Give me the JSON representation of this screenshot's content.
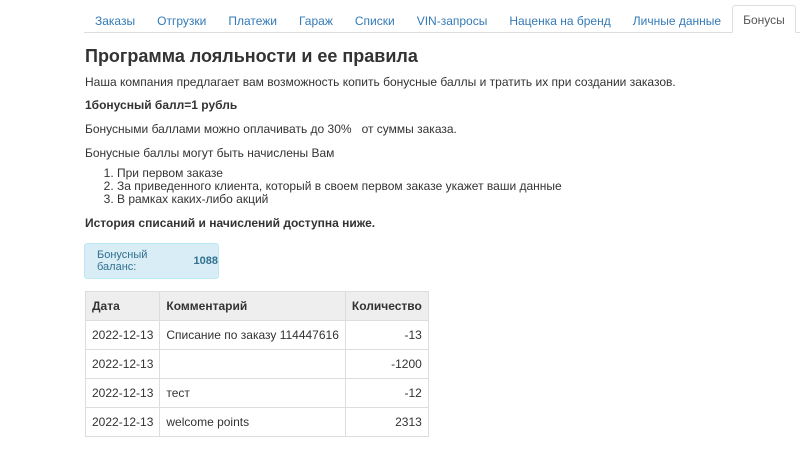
{
  "tabs": [
    {
      "label": "Заказы",
      "active": false
    },
    {
      "label": "Отгрузки",
      "active": false
    },
    {
      "label": "Платежи",
      "active": false
    },
    {
      "label": "Гараж",
      "active": false
    },
    {
      "label": "Списки",
      "active": false
    },
    {
      "label": "VIN-запросы",
      "active": false
    },
    {
      "label": "Наценка на бренд",
      "active": false
    },
    {
      "label": "Личные данные",
      "active": false
    },
    {
      "label": "Бонусы",
      "active": true
    }
  ],
  "content": {
    "title": "Программа лояльности и ее правила",
    "intro": "Наша компания предлагает вам возможность копить бонусные баллы и тратить их при создании заказов.",
    "rate": "1бонусный балл=1 рубль",
    "limit": "Бонусными баллами можно оплачивать до 30%   от суммы заказа.",
    "accrual_intro": "Бонусные баллы могут быть начислены Вам",
    "accrual_items": [
      "При первом заказе",
      "За приведенного клиента, который в своем первом заказе укажет ваши данные",
      "В рамках каких-либо акций"
    ],
    "history_note": "История списаний и начислений доступна ниже."
  },
  "balance": {
    "label": "Бонусный баланс:",
    "value": "1088"
  },
  "table": {
    "headers": [
      "Дата",
      "Комментарий",
      "Количество"
    ],
    "rows": [
      [
        "2022-12-13",
        "Списание по заказу 114447616",
        "-13"
      ],
      [
        "2022-12-13",
        "",
        "-1200"
      ],
      [
        "2022-12-13",
        "тест",
        "-12"
      ],
      [
        "2022-12-13",
        "welcome points",
        "2313"
      ]
    ]
  }
}
